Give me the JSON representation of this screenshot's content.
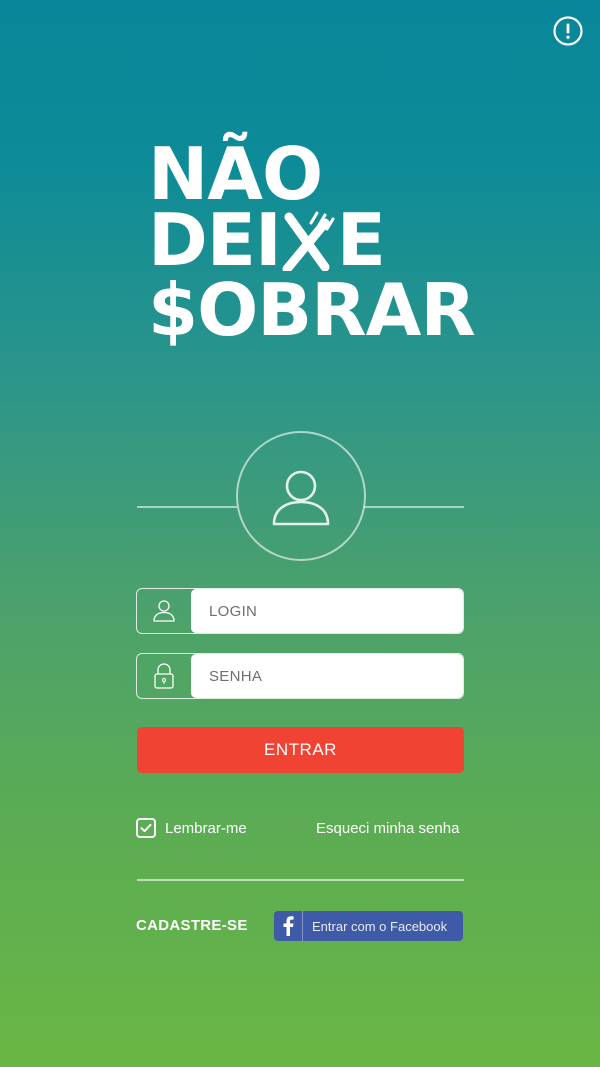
{
  "header": {
    "info_icon": "info-circle-icon"
  },
  "logo": {
    "line1": "NÃO",
    "line2_a": "DEI",
    "line2_b": "E",
    "line3": "$OBRAR"
  },
  "avatar": {
    "icon": "user-avatar-icon"
  },
  "form": {
    "login_placeholder": "LOGIN",
    "login_value": "",
    "login_icon": "user-icon",
    "password_placeholder": "SENHA",
    "password_value": "",
    "password_icon": "lock-icon",
    "enter_label": "ENTRAR",
    "remember_label": "Lembrar-me",
    "remember_checked": true,
    "forgot_label": "Esqueci minha senha"
  },
  "footer": {
    "signup_label": "CADASTRE-SE",
    "facebook_label": "Entrar com o Facebook",
    "facebook_icon": "facebook-icon"
  },
  "colors": {
    "gradient_top": "#098699",
    "gradient_bottom": "#6ab644",
    "enter_button": "#f04333",
    "facebook_button": "#3f5aa6"
  }
}
